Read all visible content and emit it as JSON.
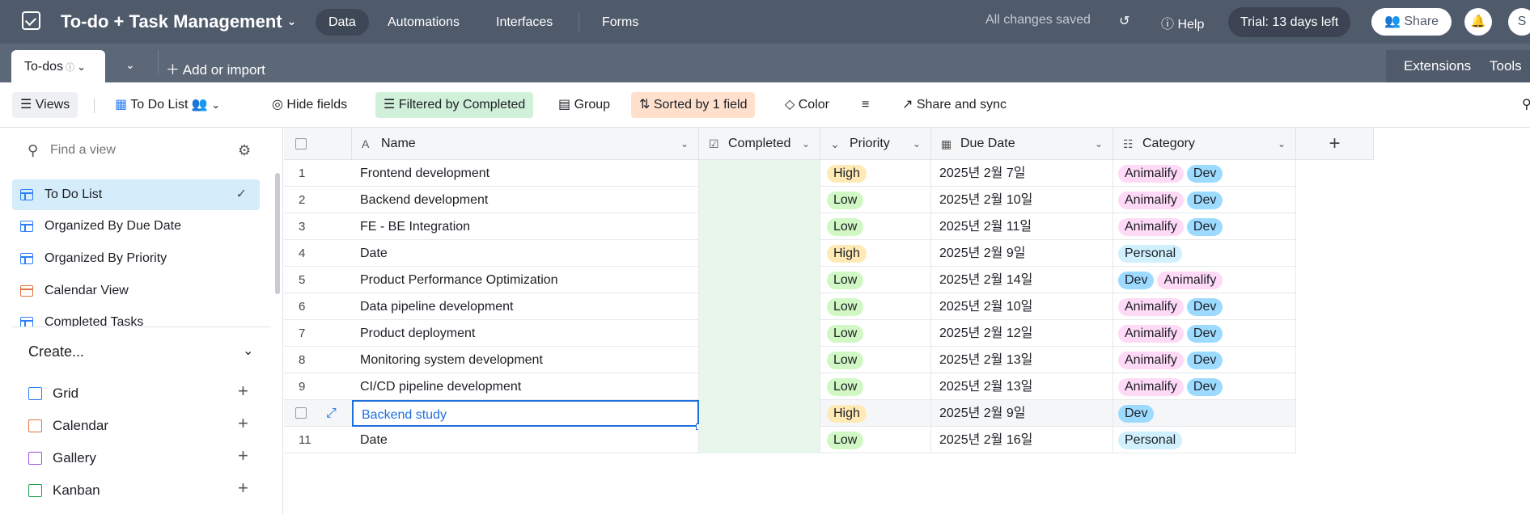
{
  "app": {
    "title": "To-do + Task Management",
    "nav": [
      "Data",
      "Automations",
      "Interfaces",
      "Forms"
    ],
    "saved_status": "All changes saved",
    "help": "Help",
    "trial": "Trial: 13 days left",
    "share": "Share",
    "avatar_initial": "S"
  },
  "tabs": {
    "active": "To-dos",
    "add_or_import": "Add or import",
    "extensions": "Extensions",
    "tools": "Tools"
  },
  "toolbar": {
    "views": "Views",
    "view_name": "To Do List",
    "hide_fields": "Hide fields",
    "filter": "Filtered by Completed",
    "group": "Group",
    "sort": "Sorted by 1 field",
    "color": "Color",
    "share_sync": "Share and sync"
  },
  "sidebar": {
    "search_placeholder": "Find a view",
    "views": [
      {
        "label": "To Do List",
        "icon": "grid-icon",
        "selected": true
      },
      {
        "label": "Organized By Due Date",
        "icon": "grid-icon"
      },
      {
        "label": "Organized By Priority",
        "icon": "grid-icon"
      },
      {
        "label": "Calendar View",
        "icon": "calendar-icon"
      },
      {
        "label": "Completed Tasks",
        "icon": "grid-icon"
      }
    ],
    "create_label": "Create...",
    "create_items": [
      {
        "label": "Grid",
        "color": "#2d7ff9"
      },
      {
        "label": "Calendar",
        "color": "#e0733e"
      },
      {
        "label": "Gallery",
        "color": "#9b51e0"
      },
      {
        "label": "Kanban",
        "color": "#20a04a"
      }
    ]
  },
  "grid": {
    "columns": [
      "Name",
      "Completed",
      "Priority",
      "Due Date",
      "Category"
    ],
    "rows": [
      {
        "num": "1",
        "name": "Frontend development",
        "priority": "High",
        "due": "2025년 2월 7일",
        "categories": [
          "Animalify",
          "Dev"
        ]
      },
      {
        "num": "2",
        "name": "Backend development",
        "priority": "Low",
        "due": "2025년 2월 10일",
        "categories": [
          "Animalify",
          "Dev"
        ]
      },
      {
        "num": "3",
        "name": "FE - BE Integration",
        "priority": "Low",
        "due": "2025년 2월 11일",
        "categories": [
          "Animalify",
          "Dev"
        ]
      },
      {
        "num": "4",
        "name": "Date",
        "priority": "High",
        "due": "2025년 2월 9일",
        "categories": [
          "Personal"
        ]
      },
      {
        "num": "5",
        "name": "Product Performance Optimization",
        "priority": "Low",
        "due": "2025년 2월 14일",
        "categories": [
          "Dev",
          "Animalify"
        ]
      },
      {
        "num": "6",
        "name": "Data pipeline development",
        "priority": "Low",
        "due": "2025년 2월 10일",
        "categories": [
          "Animalify",
          "Dev"
        ]
      },
      {
        "num": "7",
        "name": "Product deployment",
        "priority": "Low",
        "due": "2025년 2월 12일",
        "categories": [
          "Animalify",
          "Dev"
        ]
      },
      {
        "num": "8",
        "name": "Monitoring system development",
        "priority": "Low",
        "due": "2025년 2월 13일",
        "categories": [
          "Animalify",
          "Dev"
        ]
      },
      {
        "num": "9",
        "name": "CI/CD pipeline development",
        "priority": "Low",
        "due": "2025년 2월 13일",
        "categories": [
          "Animalify",
          "Dev"
        ]
      },
      {
        "num": "",
        "name": "Backend study",
        "priority": "High",
        "due": "2025년 2월 9일",
        "categories": [
          "Dev"
        ],
        "selected": true
      },
      {
        "num": "11",
        "name": "Date",
        "priority": "Low",
        "due": "2025년 2월 16일",
        "categories": [
          "Personal"
        ]
      }
    ]
  },
  "colors": {
    "High": "#ffeab6",
    "Low": "#d1f7c4",
    "Animalify": "#ffdaf6",
    "Dev": "#9cdbff",
    "Personal": "#d0f0fd"
  }
}
